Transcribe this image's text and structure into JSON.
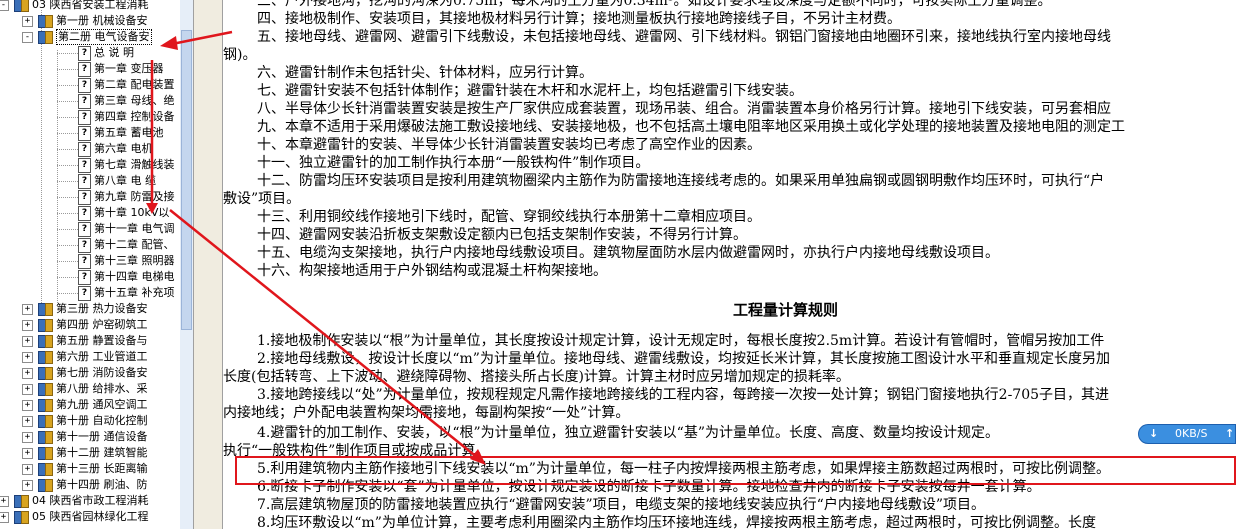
{
  "tree": {
    "nodes": [
      {
        "label": "03 陕西省安装工程消耗",
        "toggle": "-",
        "icon": "book"
      },
      {
        "label": "第一册 机械设备安",
        "toggle": "+",
        "icon": "book"
      },
      {
        "label": "第二册 电气设备安",
        "toggle": "-",
        "icon": "book",
        "selected": true
      },
      {
        "label": "总 说 明",
        "icon": "doc"
      },
      {
        "label": "第一章 变压器",
        "icon": "doc"
      },
      {
        "label": "第二章 配电装置",
        "icon": "doc"
      },
      {
        "label": "第三章 母线、绝",
        "icon": "doc"
      },
      {
        "label": "第四章 控制设备",
        "icon": "doc"
      },
      {
        "label": "第五章 蓄电池",
        "icon": "doc"
      },
      {
        "label": "第六章 电机",
        "icon": "doc"
      },
      {
        "label": "第七章 滑触线装",
        "icon": "doc"
      },
      {
        "label": "第八章 电 缆",
        "icon": "doc"
      },
      {
        "label": "第九章 防雷及接",
        "icon": "doc"
      },
      {
        "label": "第十章 10kV以",
        "icon": "doc"
      },
      {
        "label": "第十一章 电气调",
        "icon": "doc"
      },
      {
        "label": "第十二章 配管、",
        "icon": "doc"
      },
      {
        "label": "第十三章 照明器",
        "icon": "doc"
      },
      {
        "label": "第十四章 电梯电",
        "icon": "doc"
      },
      {
        "label": "第十五章 补充项",
        "icon": "doc"
      },
      {
        "label": "第三册 热力设备安",
        "toggle": "+",
        "icon": "book"
      },
      {
        "label": "第四册 炉窑砌筑工",
        "toggle": "+",
        "icon": "book"
      },
      {
        "label": "第五册 静置设备与",
        "toggle": "+",
        "icon": "book"
      },
      {
        "label": "第六册 工业管道工",
        "toggle": "+",
        "icon": "book"
      },
      {
        "label": "第七册 消防设备安",
        "toggle": "+",
        "icon": "book"
      },
      {
        "label": "第八册 给排水、采",
        "toggle": "+",
        "icon": "book"
      },
      {
        "label": "第九册 通风空调工",
        "toggle": "+",
        "icon": "book"
      },
      {
        "label": "第十册 自动化控制",
        "toggle": "+",
        "icon": "book"
      },
      {
        "label": "第十一册 通信设备",
        "toggle": "+",
        "icon": "book"
      },
      {
        "label": "第十二册 建筑智能",
        "toggle": "+",
        "icon": "book"
      },
      {
        "label": "第十三册 长距离输",
        "toggle": "+",
        "icon": "book"
      },
      {
        "label": "第十四册 刷油、防",
        "toggle": "+",
        "icon": "book"
      },
      {
        "label": "04 陕西省市政工程消耗",
        "toggle": "+",
        "icon": "book"
      },
      {
        "label": "05 陕西省园林绿化工程",
        "toggle": "+",
        "icon": "book"
      }
    ]
  },
  "content": {
    "lines": [
      {
        "text": "三、户外接地沟，挖沟的沟深为0.75m，每米沟的土方量为0.34m³。如设计要求埋设深度与定额不同时，可按实际土方量调整。"
      },
      {
        "text": "四、接地极制作、安装项目，其接地极材料另行计算；接地测量板执行接地跨接线子目，不另计主材费。"
      },
      {
        "text": "五、接地母线、避雷网、避雷引下线敷设，未包括接地母线、避雷网、引下线材料。钢铝门窗接地由地圈环引来，接地线执行室内接地母线"
      },
      {
        "text": "钢)。"
      },
      {
        "text": "六、避雷针制作未包括针尖、针体材料，应另行计算。"
      },
      {
        "text": "七、避雷针安装不包括针体制作；避雷针装在木杆和水泥杆上，均包括避雷引下线安装。"
      },
      {
        "text": "八、半导体少长针消雷装置安装是按生产厂家供应成套装置，现场吊装、组合。消雷装置本身价格另行计算。接地引下线安装，可另套相应"
      },
      {
        "text": "九、本章不适用于采用爆破法施工敷设接地线、安装接地极，也不包括高土壤电阻率地区采用换土或化学处理的接地装置及接地电阻的测定工"
      },
      {
        "text": "十、本章避雷针的安装、半导体少长针消雷装置安装均已考虑了高空作业的因素。"
      },
      {
        "text": "十一、独立避雷针的加工制作执行本册“一般铁构件”制作项目。"
      },
      {
        "text": "十二、防雷均压环安装项目是按利用建筑物圈梁内主筋作为防雷接地连接线考虑的。如果采用单独扁钢或圆钢明敷作均压环时，可执行“户"
      },
      {
        "text": "敷设”项目。"
      },
      {
        "text": "十三、利用铜绞线作接地引下线时，配管、穿铜绞线执行本册第十二章相应项目。"
      },
      {
        "text": "十四、避雷网安装沿折板支架敷设定额内已包括支架制作安装，不得另行计算。"
      },
      {
        "text": "十五、电缆沟支架接地，执行户内接地母线敷设项目。建筑物屋面防水层内做避雷网时，亦执行户内接地母线敷设项目。"
      },
      {
        "text": "十六、构架接地适用于户外钢结构或混凝土杆构架接地。"
      },
      {
        "text": "1.接地极制作安装以“根”为计量单位，其长度按设计规定计算，设计无规定时，每根长度按2.5m计算。若设计有管帽时，管帽另按加工件"
      },
      {
        "text": "2.接地母线敷设，按设计长度以“m”为计量单位。接地母线、避雷线敷设，均按延长米计算，其长度按施工图设计水平和垂直规定长度另加"
      },
      {
        "text": "长度(包括转弯、上下波动、避绕障碍物、搭接头所占长度)计算。计算主材时应另增加规定的损耗率。"
      },
      {
        "text": "3.接地跨接线以“处”为计量单位，按规程规定凡需作接地跨接线的工程内容，每跨接一次按一处计算；钢铝门窗接地执行2-705子目，其进"
      },
      {
        "text": "内接地线；户外配电装置构架均需接地，每副构架按“一处”计算。"
      },
      {
        "text": "4.避雷针的加工制作、安装，以“根”为计量单位，独立避雷针安装以“基”为计量单位。长度、高度、数量均按设计规定。"
      },
      {
        "text": "执行“一般铁构件”制作项目或按成品计算。"
      },
      {
        "text": "5.利用建筑物内主筋作接地引下线安装以“m”为计量单位，每一柱子内按焊接两根主筋考虑，如果焊接主筋数超过两根时，可按比例调整。"
      },
      {
        "text": "6.断接卡子制作安装以“套”为计量单位，按设计规定装设的断接卡子数量计算。接地检查井内的断接卡子安装按每井一套计算。"
      },
      {
        "text": "7.高层建筑物屋顶的防雷接地装置应执行“避雷网安装”项目，电缆支架的接地线安装应执行“户内接地母线敷设”项目。"
      },
      {
        "text": "8.均压环敷设以“m”为单位计算，主要考虑利用圈梁内主筋作均压环接地连线，焊接按两根主筋考虑，超过两根时，可按比例调整。长度"
      }
    ],
    "rules_heading": "工程量计算规则"
  },
  "speed_widget": {
    "down_icon": "down-arrow-icon",
    "value": "0KB/S",
    "up_icon": "up-arrow-icon"
  },
  "annotation": {
    "color": "#e0161c"
  }
}
